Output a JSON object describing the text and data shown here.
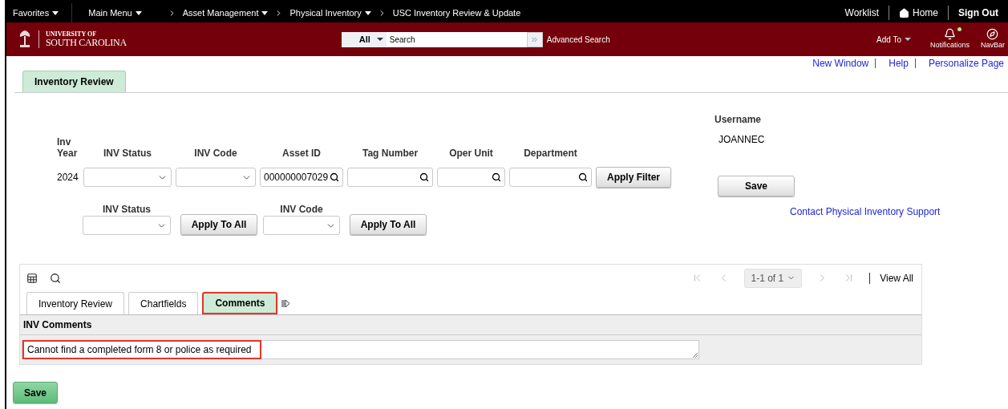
{
  "top_bar": {
    "menus": [
      {
        "label": "Favorites"
      },
      {
        "label": "Main Menu"
      }
    ],
    "breadcrumbs": [
      {
        "label": "Asset Management",
        "dropdown": true
      },
      {
        "label": "Physical Inventory",
        "dropdown": true
      },
      {
        "label": "USC Inventory Review & Update",
        "dropdown": false
      }
    ],
    "links": [
      {
        "label": "Worklist",
        "kind": "text"
      },
      {
        "label": "Home",
        "kind": "home"
      },
      {
        "label": "Sign Out",
        "kind": "bold"
      }
    ]
  },
  "header": {
    "logo_top": "UNIVERSITY OF",
    "logo_bottom": "SOUTH CAROLINA",
    "search_scope": "All",
    "search_placeholder": "Search",
    "advanced_search": "Advanced Search",
    "add_to": "Add To",
    "notifications": {
      "label": "Notifications",
      "unread": true
    },
    "navbar": "NavBar"
  },
  "page_links": [
    "New Window",
    "Help",
    "Personalize Page"
  ],
  "page_tabs": [
    {
      "label": "Inventory Review",
      "selected": true
    }
  ],
  "filters": [
    {
      "label": "Inv Year",
      "kind": "static",
      "value": "2024"
    },
    {
      "label": "INV Status",
      "kind": "select"
    },
    {
      "label": "INV Code",
      "kind": "select"
    },
    {
      "label": "Asset ID",
      "kind": "lookup",
      "value": "000000007029"
    },
    {
      "label": "Tag Number",
      "kind": "lookup"
    },
    {
      "label": "Oper Unit",
      "kind": "lookup"
    },
    {
      "label": "Department",
      "kind": "lookup"
    }
  ],
  "apply_filter": "Apply Filter",
  "mass_update": [
    {
      "label": "INV Status",
      "button": "Apply To All"
    },
    {
      "label": "INV Code",
      "button": "Apply To All"
    }
  ],
  "user": {
    "label": "Username",
    "value": "JOANNEC"
  },
  "save_top": "Save",
  "support_link": "Contact Physical Inventory Support",
  "grid": {
    "pager": "1-1 of 1",
    "view_all": "View All",
    "tabs": [
      {
        "label": "Inventory Review",
        "selected": false,
        "highlighted": false
      },
      {
        "label": "Chartfields",
        "selected": false,
        "highlighted": false
      },
      {
        "label": "Comments",
        "selected": true,
        "highlighted": true
      }
    ],
    "column": "INV Comments",
    "rows": [
      {
        "comment": "Cannot find a completed form 8 or police as required",
        "highlighted": true
      }
    ]
  },
  "save_bottom": "Save"
}
